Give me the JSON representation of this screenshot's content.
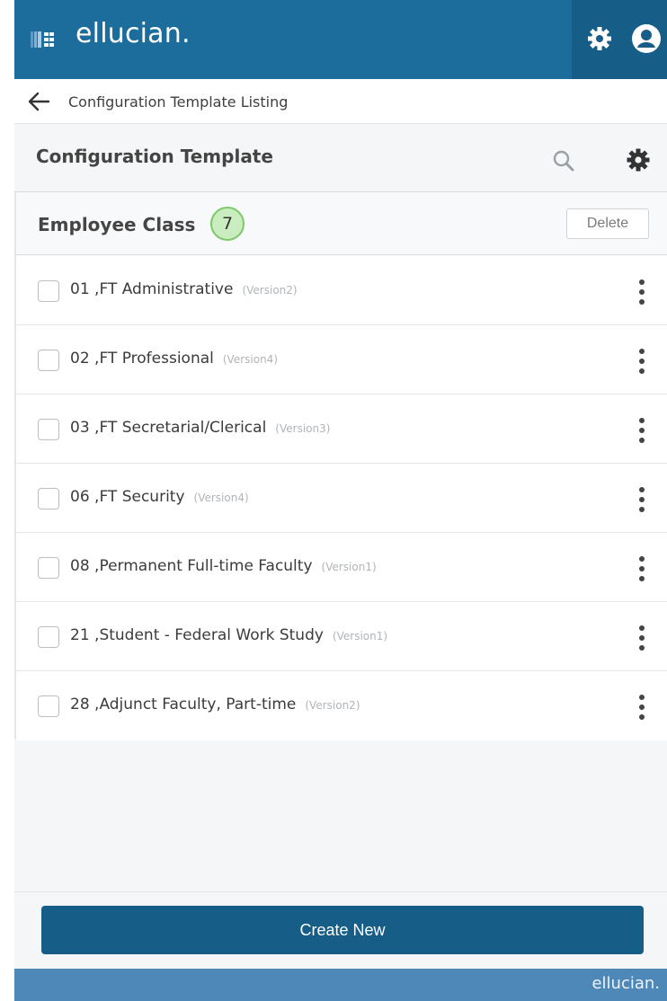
{
  "header": {
    "brand": "ellucian.",
    "icons": [
      "app-grid-icon",
      "gear-icon",
      "user-icon"
    ],
    "colors": {
      "bar": "#1c6c9c",
      "bar_dark": "#165d88"
    }
  },
  "breadcrumb": {
    "label": "Configuration Template Listing"
  },
  "section": {
    "title": "Configuration Template"
  },
  "list": {
    "title": "Employee Class",
    "count": "7",
    "delete_label": "Delete",
    "rows": [
      {
        "label": "01 ,FT Administrative",
        "version": "(Version2)"
      },
      {
        "label": "02 ,FT Professional",
        "version": "(Version4)"
      },
      {
        "label": "03 ,FT Secretarial/Clerical",
        "version": "(Version3)"
      },
      {
        "label": "06 ,FT Security",
        "version": "(Version4)"
      },
      {
        "label": "08 ,Permanent Full-time Faculty",
        "version": "(Version1)"
      },
      {
        "label": "21 ,Student - Federal Work Study",
        "version": "(Version1)"
      },
      {
        "label": "28 ,Adjunct Faculty, Part-time",
        "version": "(Version2)"
      }
    ]
  },
  "footer": {
    "create_label": "Create New",
    "brand": "ellucian."
  }
}
